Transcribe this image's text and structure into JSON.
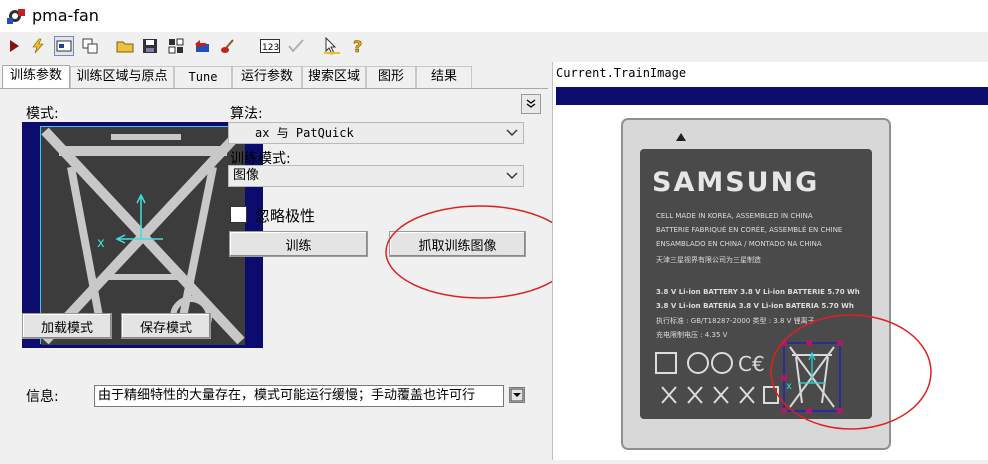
{
  "window": {
    "title": "pma-fan"
  },
  "toolbar": {
    "icons": [
      "run-icon",
      "lightning-icon",
      "view-toggle-icon",
      "copy-window-icon",
      "open-folder-icon",
      "save-icon",
      "grid-icon",
      "undo-icon",
      "brush-icon",
      "counter-123-icon",
      "check-disabled-icon",
      "pen-edit-icon",
      "help-icon"
    ]
  },
  "tabs": [
    {
      "label": "训练参数",
      "active": true
    },
    {
      "label": "训练区域与原点"
    },
    {
      "label": "Tune"
    },
    {
      "label": "运行参数"
    },
    {
      "label": "搜索区域"
    },
    {
      "label": "图形"
    },
    {
      "label": "结果"
    }
  ],
  "train": {
    "pattern_label": "模式:",
    "algorithm_label": "算法:",
    "algorithm_value": "ax 与 PatQuick",
    "train_mode_label": "训练模式:",
    "train_mode_value": "图像",
    "ignore_polarity_label": "忽略极性",
    "ignore_polarity_checked": false,
    "train_button": "训练",
    "grab_image_button": "抓取训练图像",
    "load_pattern_button": "加载模式",
    "save_pattern_button": "保存模式",
    "info_label": "信息:",
    "info_text": "由于精细特性的大量存在，模式可能运行缓慢；手动覆盖也许可行"
  },
  "image_view": {
    "title": "Current.TrainImage"
  },
  "battery": {
    "brand": "SAMSUNG",
    "line1": "CELL MADE IN KOREA, ASSEMBLED IN CHINA",
    "line2": "BATTERIE FABRIQUÉ EN CORÉE, ASSEMBLÉ EN CHINE",
    "line3": "ENSAMBLADO EN CHINA / MONTADO NA CHINA",
    "line4": "天津三星视界有限公司为三星制造",
    "spec1": "3.8 V Li-ion BATTERY 3.8 V Li-ion BATTERIE 5.70 Wh",
    "spec2": "3.8 V Li-ion BATERÍA 3.8 V Li-ion BATERIA 5.70 Wh",
    "spec3": "执行标准 : GB/T18287-2000  类型 : 3.8 V  锂离子",
    "spec4": "充电限制电压 : 4.35 V"
  },
  "colors": {
    "view_bar": "#0c0c6e",
    "annotation_red": "#e02020",
    "roi_blue": "#2020c0",
    "origin_cyan": "#20e0e0"
  }
}
